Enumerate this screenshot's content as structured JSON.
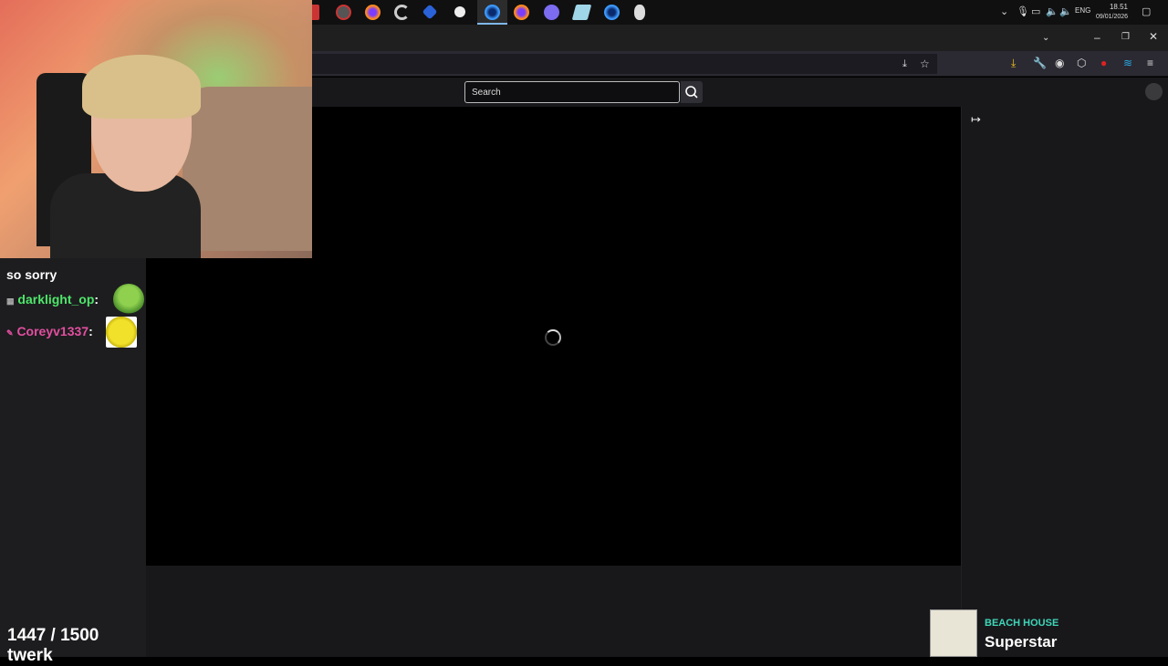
{
  "taskbar": {
    "language": "ENG",
    "time": "18.51",
    "date": "09/01/2026",
    "apps": [
      "recording-icon",
      "firefox-icon",
      "ccleaner-icon",
      "app-icon",
      "steam-icon",
      "firefox-dev-icon",
      "firefox-icon",
      "discord-icon",
      "notes-icon",
      "firefox-nightly-icon",
      "mouse-icon"
    ]
  },
  "site": {
    "search_placeholder": "Search"
  },
  "overlay_chat": {
    "messages": [
      {
        "user": "",
        "text": "so sorry"
      },
      {
        "user": "darklight_op",
        "text": ":"
      },
      {
        "user": "Coreyv1337",
        "text": ":"
      }
    ],
    "goal": "1447 / 1500 twerk"
  },
  "now_playing": {
    "artist": "BEACH HOUSE",
    "track": "Superstar"
  },
  "colors": {
    "user1": "#4ee66a",
    "user2": "#e24fa0",
    "artist": "#3fd6b8"
  }
}
